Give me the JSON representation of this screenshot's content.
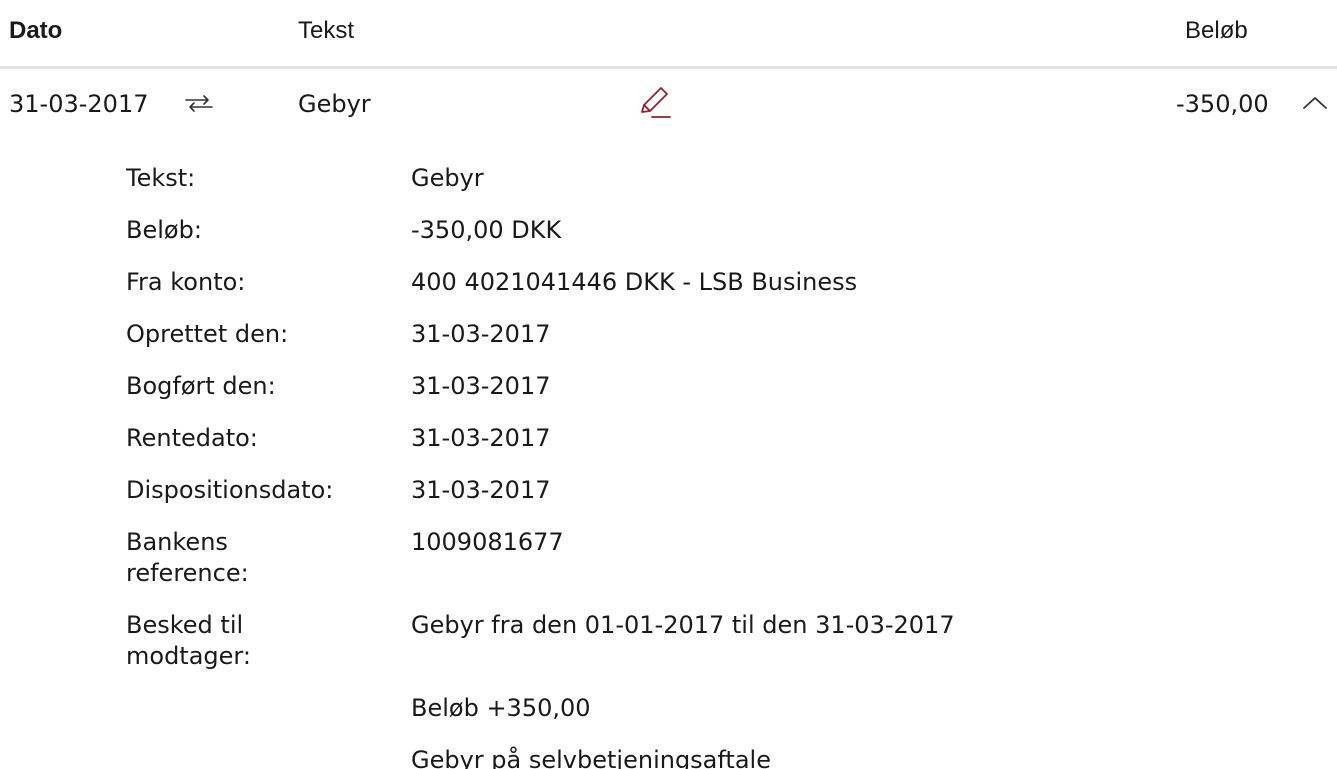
{
  "header": {
    "date_label": "Dato",
    "text_label": "Tekst",
    "amount_label": "Beløb"
  },
  "transaction": {
    "date": "31-03-2017",
    "text": "Gebyr",
    "amount": "-350,00",
    "icons": {
      "type": "transfer-arrows-icon",
      "edit": "pencil-icon",
      "collapse": "chevron-up-icon"
    },
    "edit_icon_color": "#a01c2b"
  },
  "details": [
    {
      "label": "Tekst:",
      "value": "Gebyr"
    },
    {
      "label": "Beløb:",
      "value": "-350,00 DKK"
    },
    {
      "label": "Fra konto:",
      "value": "400 4021041446 DKK - LSB Business"
    },
    {
      "label": "Oprettet den:",
      "value": "31-03-2017"
    },
    {
      "label": "Bogført den:",
      "value": "31-03-2017"
    },
    {
      "label": "Rentedato:",
      "value": "31-03-2017"
    },
    {
      "label": "Dispositionsdato:",
      "value": "31-03-2017"
    },
    {
      "label": "Bankens reference:",
      "value": "1009081677"
    },
    {
      "label": "Besked til modtager:",
      "value": "Gebyr fra den 01-01-2017 til den 31-03-2017"
    }
  ],
  "message_extra_lines": [
    "Beløb +350,00",
    "Gebyr på selvbetjeningsaftale"
  ]
}
